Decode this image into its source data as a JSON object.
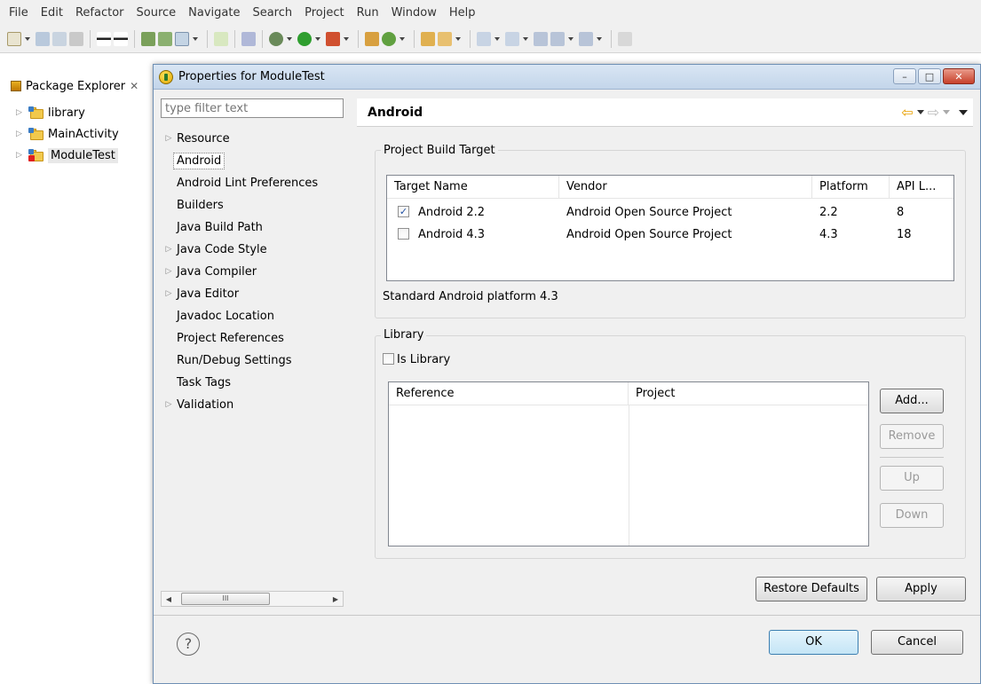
{
  "menu": [
    "File",
    "Edit",
    "Refactor",
    "Source",
    "Navigate",
    "Search",
    "Project",
    "Run",
    "Window",
    "Help"
  ],
  "package_explorer": {
    "tab_label": "Package Explorer",
    "close_glyph": "✕",
    "items": [
      {
        "label": "library"
      },
      {
        "label": "MainActivity"
      },
      {
        "label": "ModuleTest"
      }
    ]
  },
  "dialog": {
    "title": "Properties for ModuleTest",
    "window_buttons": {
      "minimize": "–",
      "maximize": "□",
      "close": "✕"
    },
    "filter_placeholder": "type filter text",
    "nav_items": [
      {
        "label": "Resource",
        "expandable": true
      },
      {
        "label": "Android",
        "expandable": false,
        "selected": true
      },
      {
        "label": "Android Lint Preferences",
        "expandable": false
      },
      {
        "label": "Builders",
        "expandable": false
      },
      {
        "label": "Java Build Path",
        "expandable": false
      },
      {
        "label": "Java Code Style",
        "expandable": true
      },
      {
        "label": "Java Compiler",
        "expandable": true
      },
      {
        "label": "Java Editor",
        "expandable": true
      },
      {
        "label": "Javadoc Location",
        "expandable": false
      },
      {
        "label": "Project References",
        "expandable": false
      },
      {
        "label": "Run/Debug Settings",
        "expandable": false
      },
      {
        "label": "Task Tags",
        "expandable": false
      },
      {
        "label": "Validation",
        "expandable": true
      }
    ],
    "scroll_thumb_glyph": "III",
    "page_title": "Android",
    "build_target": {
      "group_label": "Project Build Target",
      "columns": [
        "Target Name",
        "Vendor",
        "Platform",
        "API L..."
      ],
      "rows": [
        {
          "checked": true,
          "name": "Android 2.2",
          "vendor": "Android Open Source Project",
          "platform": "2.2",
          "api": "8"
        },
        {
          "checked": false,
          "name": "Android 4.3",
          "vendor": "Android Open Source Project",
          "platform": "4.3",
          "api": "18"
        }
      ],
      "status": "Standard Android platform 4.3"
    },
    "library": {
      "group_label": "Library",
      "is_library_label": "Is Library",
      "is_library_checked": false,
      "columns": [
        "Reference",
        "Project"
      ],
      "buttons": {
        "add": "Add...",
        "remove": "Remove",
        "up": "Up",
        "down": "Down"
      }
    },
    "restore_defaults": "Restore Defaults",
    "apply": "Apply",
    "ok": "OK",
    "cancel": "Cancel",
    "help_glyph": "?",
    "colors": {
      "accent": "#3c7fb1",
      "title_bar": "#c3d5ea",
      "dialog_bg": "#f0f0f0"
    }
  }
}
